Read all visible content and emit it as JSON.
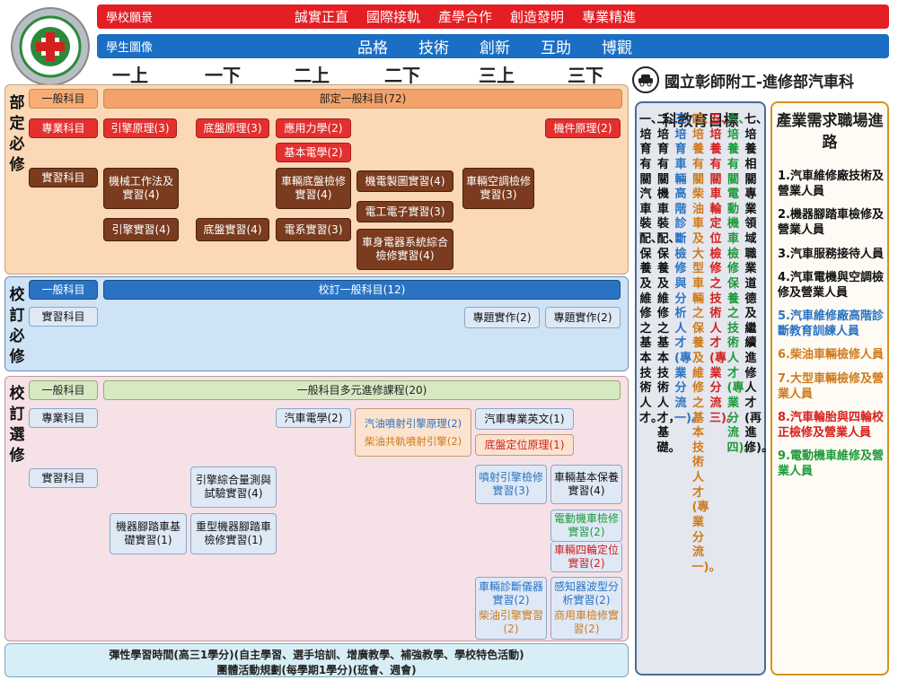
{
  "top_bars": {
    "vision_label": "學校願景",
    "vision_items": [
      "誠實正直",
      "國際接軌",
      "產學合作",
      "創造發明",
      "專業精進"
    ],
    "student_label": "學生圖像",
    "student_items": [
      "品格",
      "技術",
      "創新",
      "互助",
      "博觀"
    ]
  },
  "semesters": [
    "一上",
    "一下",
    "二上",
    "二下",
    "三上",
    "三下"
  ],
  "school_title": "國立彰師附工-進修部汽車科",
  "sections": {
    "dept_required": [
      "部",
      "定",
      "必",
      "修"
    ],
    "school_required": [
      "校",
      "訂",
      "必",
      "修"
    ],
    "school_elective": [
      "校",
      "訂",
      "選",
      "修"
    ]
  },
  "category_labels": {
    "general": "一般科目",
    "professional": "專業科目",
    "practice": "實習科目"
  },
  "dept": {
    "general_span": "部定一般科目(72)",
    "prof": [
      "引擎原理(3)",
      "底盤原理(3)",
      "應用力學(2)",
      "基本電學(2)",
      "機件原理(2)"
    ],
    "practice": [
      "機械工作法及實習(4)",
      "引擎實習(4)",
      "底盤實習(4)",
      "車輛底盤檢修實習(4)",
      "電系實習(3)",
      "機電製圖實習(4)",
      "電工電子實習(3)",
      "車身電器系統綜合檢修實習(4)",
      "車輛空調檢修實習(3)"
    ]
  },
  "school_req": {
    "general_span": "校訂一般科目(12)",
    "practice": [
      "專題實作(2)",
      "專題實作(2)"
    ]
  },
  "elective": {
    "general_span": "一般科目多元進修課程(20)",
    "prof": [
      "汽車電學(2)",
      "汽油噴射引擎原理(2)",
      "柴油共軌噴射引擎(2)",
      "汽車專業英文(1)",
      "底盤定位原理(1)"
    ],
    "practice": [
      "引擎綜合量測與試驗實習(4)",
      "機器腳踏車基礎實習(1)",
      "重型機器腳踏車檢修實習(1)",
      "噴射引擎檢修實習(3)",
      "車輛基本保養實習(4)",
      "電動機車檢修實習(2)",
      "車輛四輪定位實習(2)",
      "車輛診斷儀器實習(2)",
      "柴油引擎實習(2)",
      "感知器波型分析實習(2)",
      "商用車檢修實習(2)"
    ]
  },
  "footer": {
    "line1": "彈性學習時間(高三1學分)(自主學習、選手培訓、增廣教學、補強教學、學校特色活動)",
    "line2": "團體活動規劃(每學期1學分)(班會、週會)"
  },
  "goals": {
    "title": "科教育目標",
    "columns": [
      {
        "num": "一、",
        "text": "培育有關汽車裝配、保養及維修之基本技術人才。",
        "color": "#111111"
      },
      {
        "num": "二、",
        "text": "培育有關機車裝配、保養及維修之基本技術人才，基礎。",
        "color": "#111111"
      },
      {
        "num": "三、",
        "text": "培育車輛高階診斷檢修與分析人才(專業分流一)。",
        "color": "#2a73c3"
      },
      {
        "num": "四、",
        "text": "培養有關柴油車及大型車輛之保養及維修之基本技術人才(專業分流一)。",
        "color": "#d07a1c"
      },
      {
        "num": "五、",
        "text": "培養有關車輪定位檢修之技術人才(專業分流三)。",
        "color": "#d6201e"
      },
      {
        "num": "六、",
        "text": "培養有關電動機車檢修保養之技術人才(專業分流四)。",
        "color": "#1e9a3a"
      },
      {
        "num": "七、",
        "text": "培養相關專業領域職業道德及繼續進修人才(再進修)。",
        "color": "#111111"
      }
    ]
  },
  "industry": {
    "title": "產業需求職場進路",
    "items": [
      {
        "text": "1.汽車維修廠技術及營業人員",
        "color": "#111111"
      },
      {
        "text": "2.機器腳踏車檢修及營業人員",
        "color": "#111111"
      },
      {
        "text": "3.汽車服務接待人員",
        "color": "#111111"
      },
      {
        "text": "4.汽車電機與空調檢修及營業人員",
        "color": "#111111"
      },
      {
        "text": "5.汽車維修廠高階診斷教育訓練人員",
        "color": "#2a73c3"
      },
      {
        "text": "6.柴油車輛檢修人員",
        "color": "#d07a1c"
      },
      {
        "text": "7.大型車輛檢修及營業人員",
        "color": "#d07a1c"
      },
      {
        "text": "8.汽車輪胎與四輪校正檢修及營業人員",
        "color": "#d6201e"
      },
      {
        "text": "9.電動機車維修及營業人員",
        "color": "#1e9a3a"
      }
    ]
  }
}
